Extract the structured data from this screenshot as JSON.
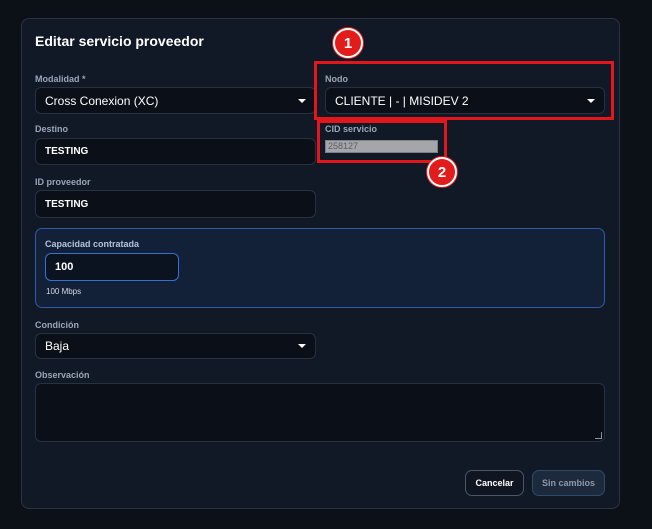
{
  "dialog": {
    "title": "Editar servicio proveedor"
  },
  "form": {
    "modalidad": {
      "label": "Modalidad *",
      "value": "Cross Conexion (XC)"
    },
    "nodo": {
      "label": "Nodo",
      "value": "CLIENTE | - | MISIDEV 2"
    },
    "destino": {
      "label": "Destino",
      "value": "TESTING"
    },
    "cid_servicio": {
      "label": "CID servicio",
      "value": "258127"
    },
    "id_proveedor": {
      "label": "ID proveedor",
      "value": "TESTING"
    },
    "capacidad": {
      "label": "Capacidad contratada",
      "value": "100",
      "hint": "100 Mbps"
    },
    "condicion": {
      "label": "Condición",
      "value": "Baja"
    },
    "observacion": {
      "label": "Observación",
      "value": ""
    }
  },
  "buttons": {
    "cancel": "Cancelar",
    "save": "Sin cambios"
  },
  "annotations": {
    "badge1": "1",
    "badge2": "2",
    "highlight_color": "#e3161b"
  }
}
